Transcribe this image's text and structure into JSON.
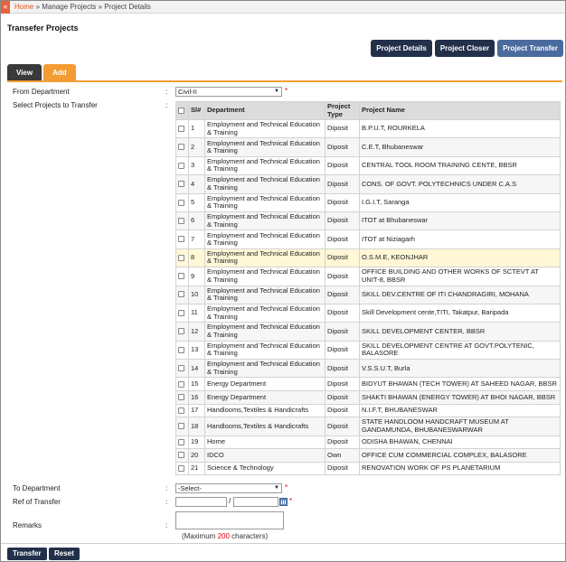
{
  "breadcrumb": {
    "home": "Home",
    "sep": "»",
    "manage": "Manage Projects",
    "current": "Project Details"
  },
  "title": "Transefer Projects",
  "top_buttons": [
    "Project Details",
    "Project Closer",
    "Project Transfer"
  ],
  "tabs": [
    "View",
    "Add"
  ],
  "form": {
    "from_department_label": "From Department",
    "from_department_value": "Civil-II",
    "select_projects_label": "Select Projects to Transfer",
    "to_department_label": "To Department",
    "to_department_value": "-Select-",
    "ref_label": "Ref of Transfer",
    "ref_sep": "/",
    "remarks_label": "Remarks",
    "max_prefix": "(Maximum",
    "max_value": "200",
    "max_suffix": "characters)",
    "colon": ":",
    "required": "*"
  },
  "table": {
    "headers": [
      "Sl#",
      "Department",
      "Project Type",
      "Project Name"
    ],
    "rows": [
      [
        "1",
        "Employment and Technical Education & Training",
        "Diposit",
        "B.P.U.T, ROURKELA"
      ],
      [
        "2",
        "Employment and Technical Education & Training",
        "Diposit",
        "C.E.T, Bhubaneswar"
      ],
      [
        "3",
        "Employment and Technical Education & Training",
        "Diposit",
        "CENTRAL TOOL ROOM TRAINING CENTE, BBSR"
      ],
      [
        "4",
        "Employment and Technical Education & Training",
        "Diposit",
        "CONS. OF GOVT. POLYTECHNICS UNDER C.A.S"
      ],
      [
        "5",
        "Employment and Technical Education & Training",
        "Diposit",
        "I.G.I.T, Saranga"
      ],
      [
        "6",
        "Employment and Technical Education & Training",
        "Diposit",
        "ITOT at Bhubaneswar"
      ],
      [
        "7",
        "Employment and Technical Education & Training",
        "Diposit",
        "ITOT at Niziagarh"
      ],
      [
        "8",
        "Employment and Technical Education & Training",
        "Diposit",
        "O.S.M.E, KEONJHAR"
      ],
      [
        "9",
        "Employment and Technical Education & Training",
        "Diposit",
        "OFFICE BUILDING AND OTHER WORKS OF SCTEVT AT UNIT-8, BBSR"
      ],
      [
        "10",
        "Employment and Technical Education & Training",
        "Diposit",
        "SKILL DEV.CENTRE OF ITI CHANDRAGIRI, MOHANA"
      ],
      [
        "11",
        "Employment and Technical Education & Training",
        "Diposit",
        "Skill Development cente,TITI, Takatpur, Baripada"
      ],
      [
        "12",
        "Employment and Technical Education & Training",
        "Diposit",
        "SKILL DEVELOPMENT CENTER, BBSR"
      ],
      [
        "13",
        "Employment and Technical Education & Training",
        "Diposit",
        "SKILL DEVELOPMENT CENTRE AT GOVT.POLYTENIC, BALASORE"
      ],
      [
        "14",
        "Employment and Technical Education & Training",
        "Diposit",
        "V.S.S.U.T, Burla"
      ],
      [
        "15",
        "Energy Department",
        "Diposit",
        "BIDYUT BHAWAN (TECH TOWER) AT SAHEED NAGAR, BBSR"
      ],
      [
        "16",
        "Energy Department",
        "Diposit",
        "SHAKTI BHAWAN (ENERGY TOWER) AT BHOI NAGAR, BBSR"
      ],
      [
        "17",
        "Handlooms,Textiles & Handicrafts",
        "Diposit",
        "N.I.F.T, BHUBANESWAR"
      ],
      [
        "18",
        "Handlooms,Textiles & Handicrafts",
        "Diposit",
        "STATE HANDLOOM HANDCRAFT MUSEUM AT GANDAMUNDA, BHUBANESWARWAR"
      ],
      [
        "19",
        "Home",
        "Diposit",
        "ODISHA BHAWAN, CHENNAI"
      ],
      [
        "20",
        "IDCO",
        "Own",
        "OFFICE CUM COMMERCIAL COMPLEX, BALASORE"
      ],
      [
        "21",
        "Science & Technology",
        "Diposit",
        "RENOVATION WORK OF PS PLANETARIUM"
      ]
    ]
  },
  "bottom_buttons": [
    "Transfer",
    "Reset"
  ],
  "colors": {
    "accent": "#f39c34",
    "dark_button": "#22304a",
    "highlight_row": "#fff7d6",
    "home_tab": "#e8613a"
  }
}
